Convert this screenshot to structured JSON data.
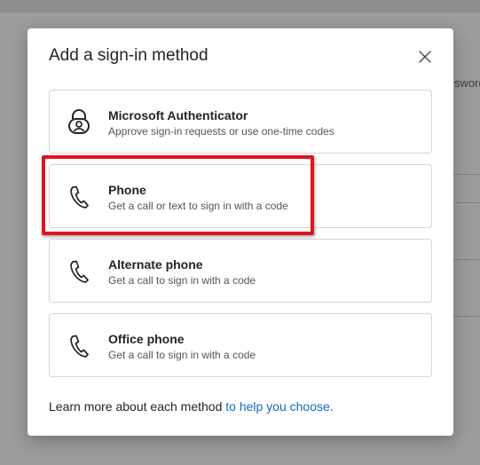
{
  "background": {
    "fragment_text": "sword"
  },
  "dialog": {
    "title": "Add a sign-in method",
    "close_icon": "close-icon",
    "methods": [
      {
        "name": "Microsoft Authenticator",
        "description": "Approve sign-in requests or use one-time codes",
        "icon": "authenticator-lock-icon"
      },
      {
        "name": "Phone",
        "description": "Get a call or text to sign in with a code",
        "icon": "phone-icon",
        "highlighted": true
      },
      {
        "name": "Alternate phone",
        "description": "Get a call to sign in with a code",
        "icon": "phone-icon"
      },
      {
        "name": "Office phone",
        "description": "Get a call to sign in with a code",
        "icon": "phone-icon"
      }
    ],
    "footer": {
      "text": "Learn more about each method ",
      "link_text": "to help you choose."
    }
  },
  "colors": {
    "highlight": "#e0141e",
    "link": "#0f6cbd"
  }
}
